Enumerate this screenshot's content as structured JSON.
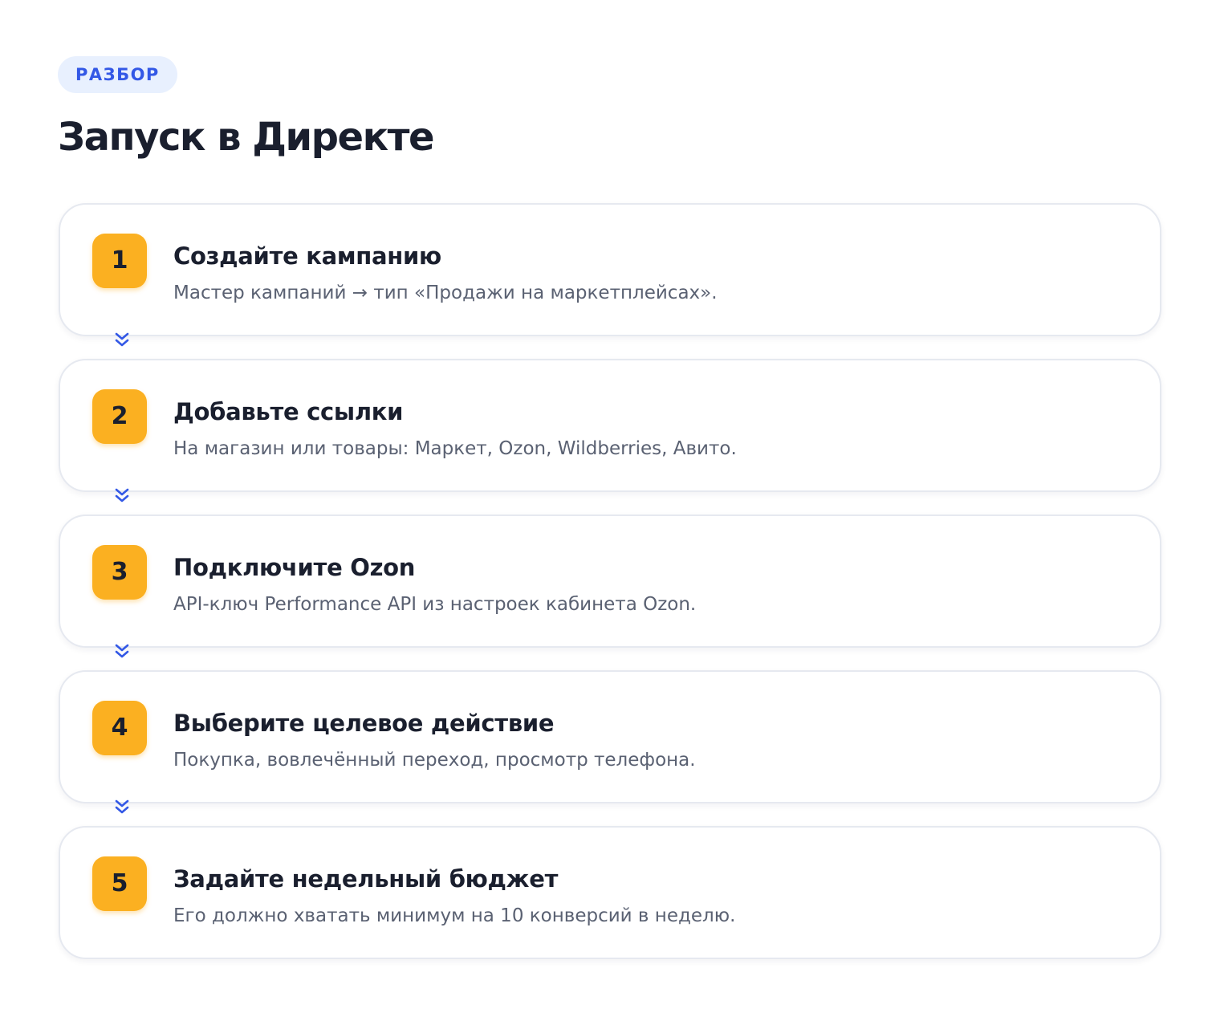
{
  "header": {
    "tag": "РАЗБОР",
    "title": "Запуск в Директе"
  },
  "colors": {
    "accent": "#3358e6",
    "badge_bg": "#fbb021",
    "tag_bg": "#e8f0fe",
    "title": "#1a1f2e",
    "text_secondary": "#5a6172"
  },
  "connector_icon": "double-chevron-down-icon",
  "steps": [
    {
      "number": "1",
      "title": "Создайте кампанию",
      "description": "Мастер кампаний → тип «Продажи на маркетплейсах»."
    },
    {
      "number": "2",
      "title": "Добавьте ссылки",
      "description": "На магазин или товары: Маркет, Ozon, Wildberries, Авито."
    },
    {
      "number": "3",
      "title": "Подключите Ozon",
      "description": "API-ключ Performance API из настроек кабинета Ozon."
    },
    {
      "number": "4",
      "title": "Выберите целевое действие",
      "description": "Покупка, вовлечённый переход, просмотр телефона."
    },
    {
      "number": "5",
      "title": "Задайте недельный бюджет",
      "description": "Его должно хватать минимум на 10 конверсий в неделю."
    }
  ]
}
